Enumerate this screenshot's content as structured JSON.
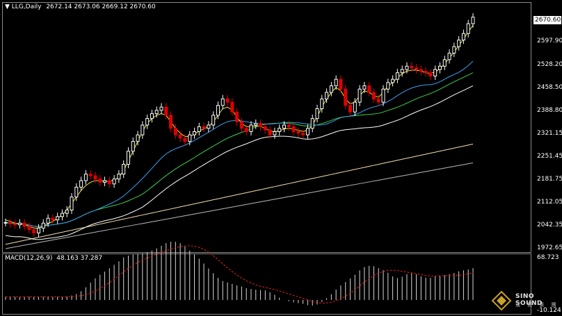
{
  "header": {
    "symbol_line": "LLG,Daily",
    "ohlc": "2672.14 2673.06 2669.12 2670.60",
    "macd_label": "MACD(12,26,9)",
    "macd_values": "48.163 37.287"
  },
  "price_axis": {
    "current_price": "2670.60",
    "ticks": [
      "2597.90",
      "2528.20",
      "2458.50",
      "2388.80",
      "2321.15",
      "2251.45",
      "2181.75",
      "2112.05",
      "2042.35",
      "1972.65"
    ]
  },
  "macd_axis": {
    "top": "68.723",
    "bottom": "-10.124"
  },
  "logo": {
    "name": "SINO SOUND",
    "sub": "漢 聲 集 團"
  },
  "colors": {
    "bull": "#ffffff",
    "bear": "#e00000",
    "ma_fast": "#f2e83a",
    "ma_mid": "#3aa0f0",
    "ma_slow": "#3bd24a",
    "ma_long": "#ffffff",
    "ma_200": "#f5deb3",
    "ma_300": "#b9b9b9",
    "macd_hist": "#d8d8d8",
    "macd_signal": "#e02020"
  },
  "chart_data": {
    "type": "line",
    "title": "LLG,Daily",
    "ylim": [
      1962,
      2680
    ],
    "series": [
      {
        "name": "close",
        "values": [
          2042,
          2038,
          2035,
          2040,
          2030,
          2020,
          2010,
          2025,
          2040,
          2055,
          2050,
          2060,
          2070,
          2080,
          2120,
          2150,
          2170,
          2190,
          2185,
          2175,
          2165,
          2170,
          2160,
          2175,
          2190,
          2220,
          2260,
          2290,
          2310,
          2340,
          2360,
          2375,
          2385,
          2395,
          2370,
          2330,
          2310,
          2300,
          2290,
          2310,
          2320,
          2335,
          2330,
          2340,
          2370,
          2400,
          2420,
          2410,
          2380,
          2350,
          2330,
          2320,
          2340,
          2345,
          2335,
          2325,
          2310,
          2320,
          2330,
          2340,
          2335,
          2320,
          2315,
          2310,
          2330,
          2360,
          2390,
          2420,
          2440,
          2460,
          2480,
          2450,
          2400,
          2380,
          2410,
          2450,
          2460,
          2440,
          2420,
          2410,
          2450,
          2470,
          2480,
          2500,
          2510,
          2520,
          2515,
          2510,
          2505,
          2500,
          2490,
          2510,
          2520,
          2540,
          2560,
          2580,
          2600,
          2620,
          2650,
          2670
        ]
      },
      {
        "name": "ma_fast",
        "values": [
          2050,
          2045,
          2040,
          2038,
          2036,
          2030,
          2025,
          2025,
          2030,
          2038,
          2045,
          2055,
          2065,
          2080,
          2100,
          2120,
          2140,
          2155,
          2165,
          2170,
          2170,
          2168,
          2168,
          2172,
          2180,
          2200,
          2230,
          2260,
          2290,
          2320,
          2345,
          2360,
          2370,
          2375,
          2370,
          2350,
          2330,
          2315,
          2305,
          2305,
          2312,
          2322,
          2328,
          2335,
          2350,
          2370,
          2390,
          2395,
          2385,
          2365,
          2345,
          2335,
          2335,
          2338,
          2336,
          2330,
          2322,
          2320,
          2322,
          2328,
          2330,
          2328,
          2324,
          2320,
          2325,
          2340,
          2365,
          2395,
          2420,
          2440,
          2455,
          2445,
          2420,
          2405,
          2410,
          2430,
          2445,
          2440,
          2430,
          2425,
          2440,
          2460,
          2470,
          2485,
          2497,
          2505,
          2508,
          2508,
          2505,
          2500,
          2498,
          2502,
          2512,
          2528,
          2545,
          2563,
          2583,
          2603,
          2625,
          2645
        ]
      }
    ]
  }
}
